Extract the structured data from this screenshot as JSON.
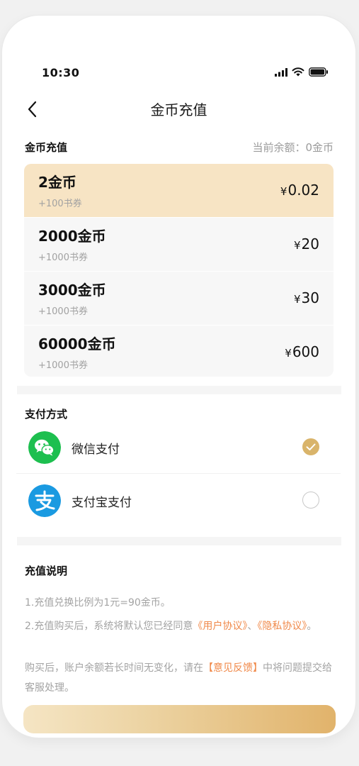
{
  "status": {
    "time": "10:30"
  },
  "nav": {
    "title": "金币充值"
  },
  "recharge": {
    "section_title": "金币充值",
    "balance_label": "当前余额：0金币",
    "packages": [
      {
        "coins": "2金币",
        "bonus": "+100书券",
        "currency": "¥",
        "price": "0.02",
        "selected": true
      },
      {
        "coins": "2000金币",
        "bonus": "+1000书券",
        "currency": "¥",
        "price": "20",
        "selected": false
      },
      {
        "coins": "3000金币",
        "bonus": "+1000书券",
        "currency": "¥",
        "price": "30",
        "selected": false
      },
      {
        "coins": "60000金币",
        "bonus": "+1000书券",
        "currency": "¥",
        "price": "600",
        "selected": false
      }
    ]
  },
  "payment": {
    "title": "支付方式",
    "methods": [
      {
        "label": "微信支付",
        "icon": "wechat-icon",
        "selected": true
      },
      {
        "label": "支付宝支付",
        "icon": "alipay-icon",
        "selected": false
      }
    ]
  },
  "notes": {
    "title": "充值说明",
    "line1": "1.充值兑换比例为1元=90金币。",
    "line2_prefix": "2.充值购买后，系统将默认您已经同意",
    "user_agreement": "《用户协议》",
    "separator": "、",
    "privacy_agreement": "《隐私协议》",
    "line2_suffix": "。",
    "line3_prefix": "购买后，账户余额若长时间无变化，请在",
    "feedback_link": "【意见反馈】",
    "line3_suffix": "中将问题提交给客服处理。"
  },
  "colors": {
    "selected_bg": "#f7e4c4",
    "accent_gold": "#d9b46a",
    "link_orange": "#f0894a",
    "wechat_green": "#1dbf4f",
    "alipay_blue": "#1a9ae1"
  }
}
